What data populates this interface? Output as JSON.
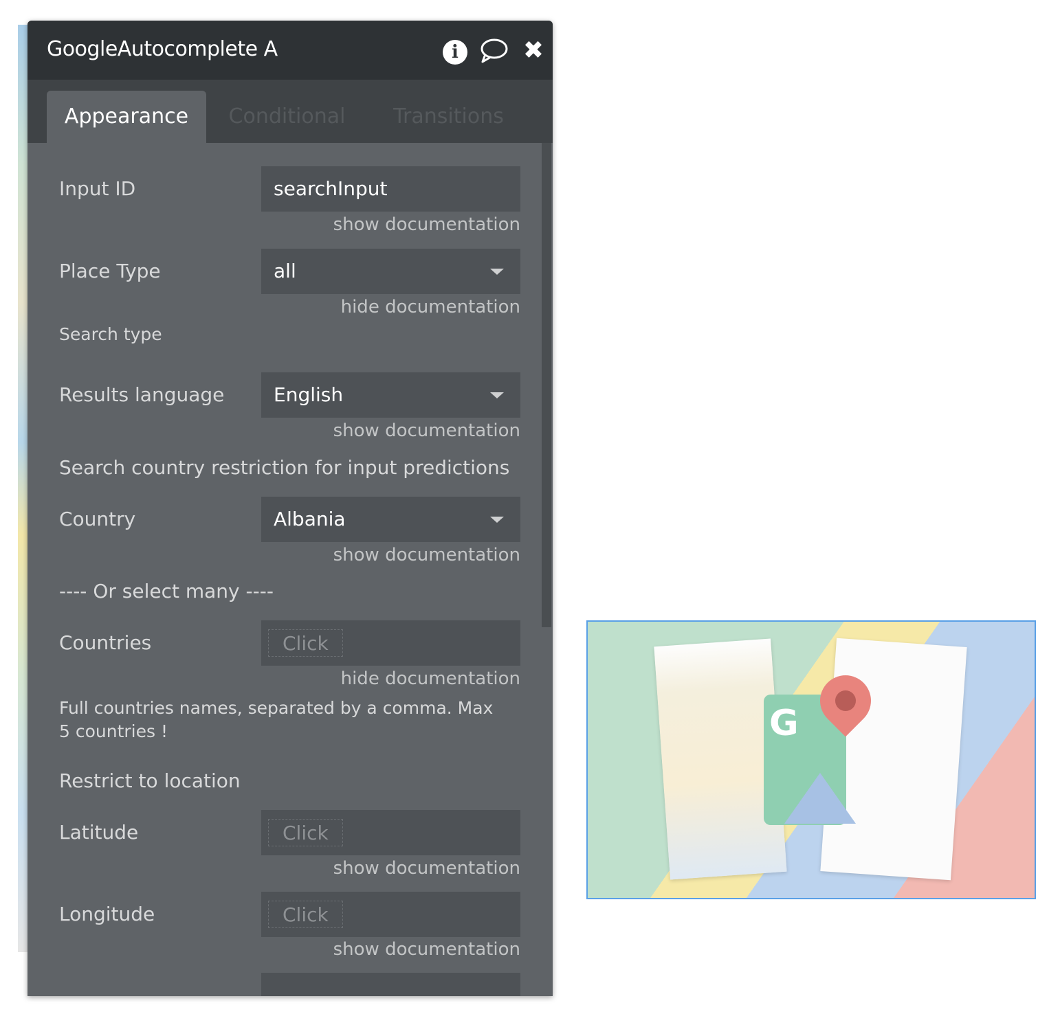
{
  "panel": {
    "title": "GoogleAutocomplete A",
    "tabs": [
      {
        "label": "Appearance",
        "active": true
      },
      {
        "label": "Conditional",
        "active": false
      },
      {
        "label": "Transitions",
        "active": false
      }
    ]
  },
  "fields": {
    "input_id": {
      "label": "Input ID",
      "value": "searchInput",
      "doc": "show documentation"
    },
    "place_type": {
      "label": "Place Type",
      "value": "all",
      "doc": "hide documentation",
      "doc_text": "Search type"
    },
    "results_language": {
      "label": "Results language",
      "value": "English",
      "doc": "show documentation"
    },
    "country_section": "Search country restriction for input predictions",
    "country": {
      "label": "Country",
      "value": "Albania",
      "doc": "show documentation"
    },
    "or_select": "---- Or select many ----",
    "countries": {
      "label": "Countries",
      "placeholder": "Click",
      "doc": "hide documentation",
      "doc_text": "Full countries names, separated by a comma. Max 5 countries !"
    },
    "restrict_section": "Restrict to location",
    "latitude": {
      "label": "Latitude",
      "placeholder": "Click",
      "doc": "show documentation"
    },
    "longitude": {
      "label": "Longitude",
      "placeholder": "Click",
      "doc": "show documentation"
    }
  },
  "colors": {
    "panel_bg": "#5f6367",
    "title_bar": "#2e3235",
    "tab_bar": "#3f4346",
    "field_bg": "#4e5256",
    "preview_border": "#5aa0e6"
  },
  "icons": [
    "info-icon",
    "comment-icon",
    "close-icon",
    "dropdown-caret-icon",
    "google-maps-logo-icon"
  ]
}
